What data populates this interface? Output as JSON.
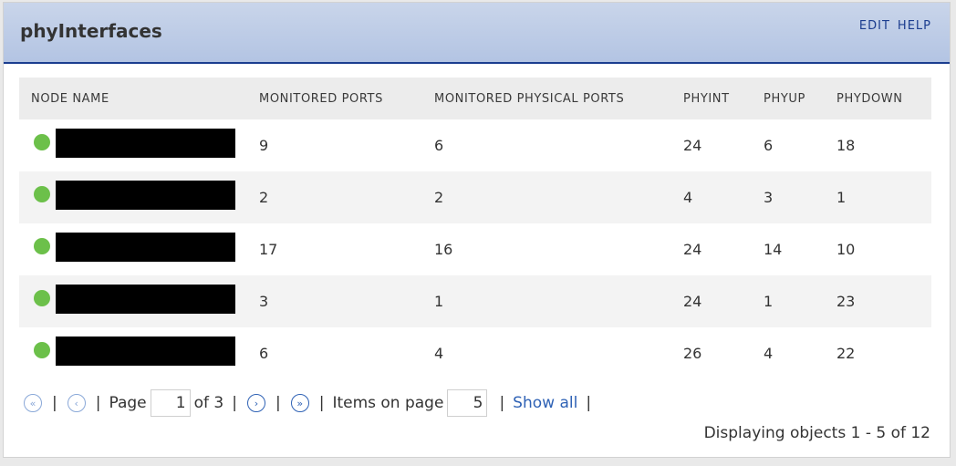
{
  "panel": {
    "title": "phyInterfaces",
    "actions": [
      "EDIT",
      "HELP"
    ]
  },
  "table": {
    "columns": [
      "NODE NAME",
      "MONITORED PORTS",
      "MONITORED PHYSICAL PORTS",
      "PHYINT",
      "PHYUP",
      "PHYDOWN"
    ],
    "rows": [
      {
        "status": "up",
        "name": "",
        "monitored_ports": "9",
        "monitored_physical_ports": "6",
        "phyint": "24",
        "phyup": "6",
        "phydown": "18"
      },
      {
        "status": "up",
        "name": "",
        "monitored_ports": "2",
        "monitored_physical_ports": "2",
        "phyint": "4",
        "phyup": "3",
        "phydown": "1"
      },
      {
        "status": "up",
        "name": "",
        "monitored_ports": "17",
        "monitored_physical_ports": "16",
        "phyint": "24",
        "phyup": "14",
        "phydown": "10"
      },
      {
        "status": "up",
        "name": "",
        "monitored_ports": "3",
        "monitored_physical_ports": "1",
        "phyint": "24",
        "phyup": "1",
        "phydown": "23"
      },
      {
        "status": "up",
        "name": "",
        "monitored_ports": "6",
        "monitored_physical_ports": "4",
        "phyint": "26",
        "phyup": "4",
        "phydown": "22"
      }
    ]
  },
  "pager": {
    "page_label": "Page",
    "page_value": "1",
    "of_label": "of 3",
    "items_label": "Items on page",
    "items_value": "5",
    "show_all": "Show all",
    "separator": "|"
  },
  "summary": "Displaying objects 1 - 5 of 12",
  "colors": {
    "status_up": "#6cc04a",
    "header_accent": "#1b3d8f",
    "link": "#2f62b5"
  },
  "icons": {
    "first": "double-chevron-left-icon",
    "prev": "chevron-left-icon",
    "next": "chevron-right-icon",
    "last": "double-chevron-right-icon"
  }
}
